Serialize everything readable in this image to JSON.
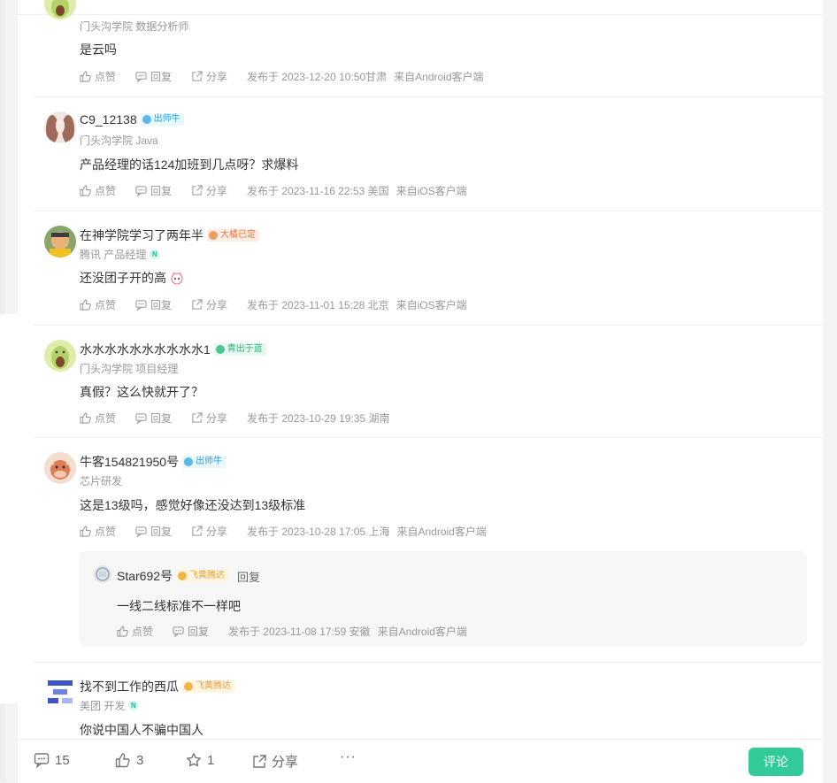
{
  "comments": [
    {
      "meta": "门头沟学院 数据分析师",
      "content": "是云吗",
      "like": "点赞",
      "reply": "回复",
      "share": "分享",
      "published": "发布于 2023-12-20 10:50甘肃",
      "client": "来自Android客户端"
    },
    {
      "username": "C9_12138",
      "badge": "出师牛",
      "meta": "门头沟学院 Java",
      "content": "产品经理的话124加班到几点呀？求爆料",
      "like": "点赞",
      "reply": "回复",
      "share": "分享",
      "published": "发布于 2023-11-16 22:53 美国",
      "client": "来自iOS客户端"
    },
    {
      "username": "在神学院学习了两年半",
      "badge": "大橘已定",
      "meta": "腾讯 产品经理",
      "meta_badge": "N",
      "content": "还没团子开的高",
      "like": "点赞",
      "reply": "回复",
      "share": "分享",
      "published": "发布于 2023-11-01 15:28 北京",
      "client": "来自iOS客户端"
    },
    {
      "username": "水水水水水水水水水水1",
      "badge": "青出于蓝",
      "meta": "门头沟学院 项目经理",
      "content": "真假？这么快就开了？",
      "like": "点赞",
      "reply": "回复",
      "share": "分享",
      "published": "发布于 2023-10-29 19:35 湖南"
    },
    {
      "username": "牛客154821950号",
      "badge": "出师牛",
      "meta": "芯片研发",
      "content": "这是13级吗，感觉好像还没达到13级标准",
      "like": "点赞",
      "reply": "回复",
      "share": "分享",
      "published": "发布于 2023-10-28 17:05 上海",
      "client": "来自Android客户端",
      "reply_item": {
        "username": "Star692号",
        "badge": "飞黄腾达",
        "reply_label": "回复",
        "content": "一线二线标准不一样吧",
        "like": "点赞",
        "reply": "回复",
        "published": "发布于 2023-11-08 17:59 安徽",
        "client": "来自Android客户端"
      }
    },
    {
      "username": "找不到工作的西瓜",
      "badge": "飞黄腾达",
      "meta": "美团 开发",
      "meta_badge": "N",
      "content": "你说中国人不骗中国人"
    }
  ],
  "bottom_bar": {
    "comments_count": "15",
    "likes_count": "3",
    "favorites_count": "1",
    "share_label": "分享",
    "more_label": "···",
    "comment_button": "评论"
  },
  "colors": {
    "accent": "#32ca99",
    "badge_blue": "#2a9fd8",
    "badge_orange": "#e9753b",
    "badge_green": "#2bb37a",
    "badge_gold": "#e6a13a"
  }
}
